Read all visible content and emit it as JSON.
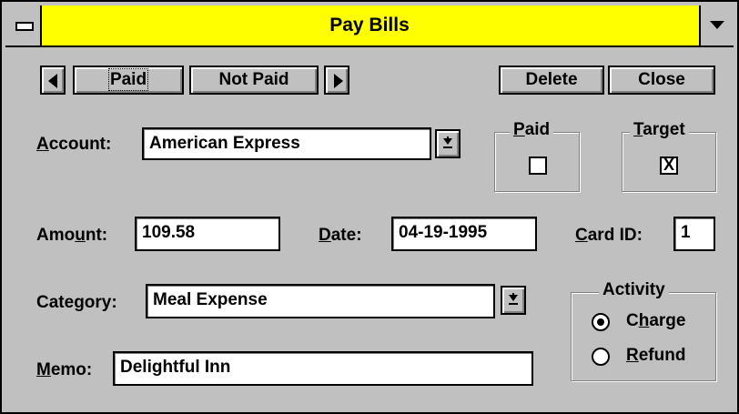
{
  "window": {
    "title": "Pay Bills"
  },
  "nav": {
    "prev_icon": "arrow-left",
    "next_icon": "arrow-right"
  },
  "toolbar": {
    "paid_tab": "Paid",
    "not_paid_tab": "Not Paid",
    "delete_label": "Delete",
    "close_label": "Close"
  },
  "account": {
    "label_prefix": "",
    "label_accel": "A",
    "label_rest": "ccount:",
    "value": "American Express"
  },
  "paid_box": {
    "title_accel": "P",
    "title_rest": "aid",
    "checked": false
  },
  "target_box": {
    "title_accel": "T",
    "title_rest": "arget",
    "checked": true,
    "mark": "X"
  },
  "amount": {
    "label_prefix": "Amo",
    "label_accel": "u",
    "label_rest": "nt:",
    "value": "109.58"
  },
  "date": {
    "label_accel": "D",
    "label_rest": "ate:",
    "value": "04-19-1995"
  },
  "card": {
    "label_accel": "C",
    "label_rest": "ard ID:",
    "value": "1"
  },
  "category": {
    "label_prefix": "Cate",
    "label_accel": "g",
    "label_rest": "ory:",
    "value": "Meal Expense"
  },
  "memo": {
    "label_accel": "M",
    "label_rest": "emo:",
    "value": "Delightful Inn"
  },
  "activity": {
    "title": "Activity",
    "options": [
      {
        "prefix": "C",
        "accel": "h",
        "rest": "arge",
        "selected": true
      },
      {
        "prefix": "",
        "accel": "R",
        "rest": "efund",
        "selected": false
      }
    ]
  },
  "colors": {
    "title_bar": "#ffff00",
    "face": "#c0c0c0",
    "frame": "#000000"
  }
}
